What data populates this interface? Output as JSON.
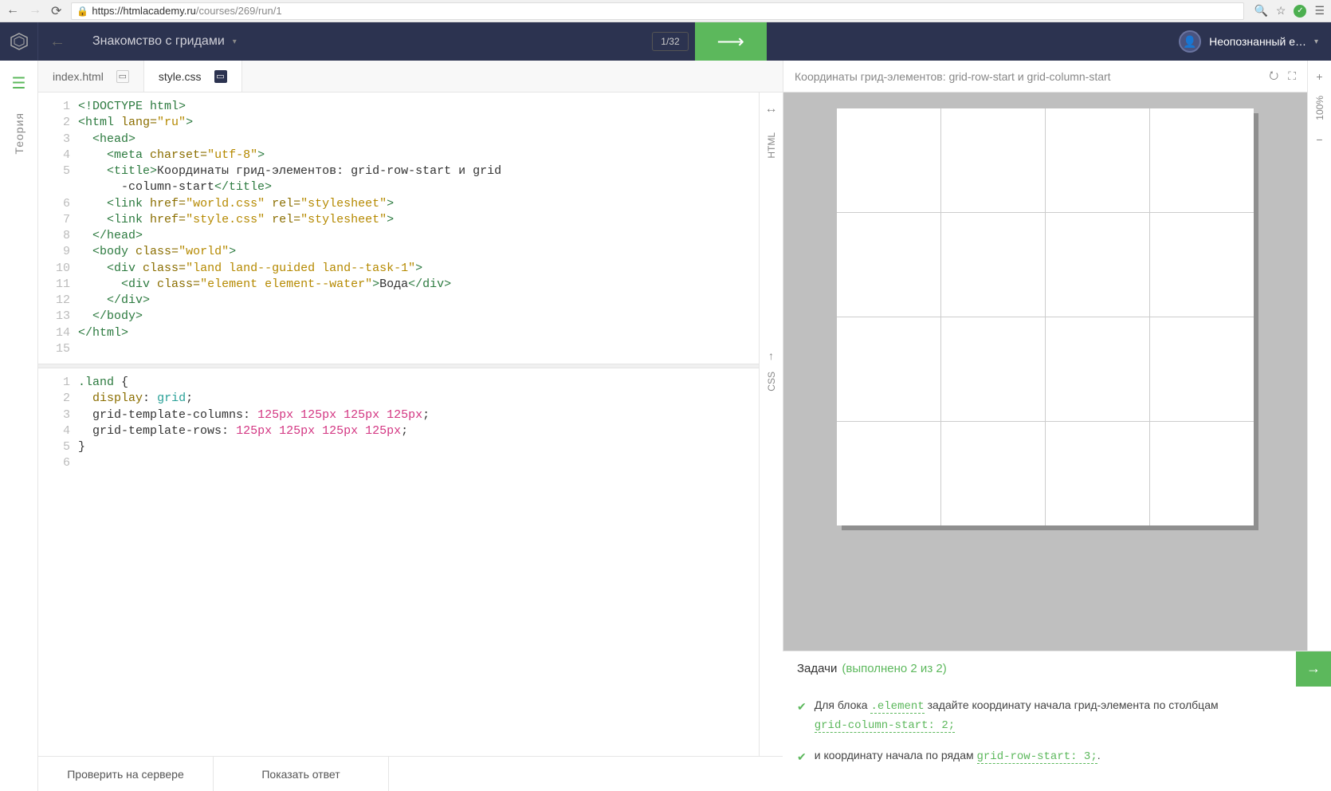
{
  "browser": {
    "url_scheme": "https",
    "url_host": "://htmlacademy.ru",
    "url_path": "/courses/269/run/1"
  },
  "header": {
    "course_title": "Знакомство с гридами",
    "progress": "1/32",
    "username": "Неопознанный е…"
  },
  "sidebar": {
    "theory_label": "Теория"
  },
  "tabs": [
    {
      "label": "index.html"
    },
    {
      "label": "style.css"
    }
  ],
  "lang_labels": {
    "html": "HTML",
    "css": "CSS"
  },
  "preview": {
    "title": "Координаты грид-элементов: grid-row-start и grid-column-start",
    "zoom": "100%"
  },
  "tasks": {
    "title": "Задачи",
    "progress": "(выполнено 2 из 2)",
    "items": [
      {
        "pre": "Для блока ",
        "code1": ".element",
        "mid": " задайте координату начала грид-элемента по столбцам ",
        "code2": "grid-column-start: 2;",
        "post": ""
      },
      {
        "pre": "и координату начала по рядам ",
        "code1": "grid-row-start: 3;",
        "mid": "",
        "code2": "",
        "post": "."
      }
    ]
  },
  "footer": {
    "check": "Проверить на сервере",
    "answer": "Показать ответ"
  },
  "html_code": {
    "lines": 15,
    "l1": "<!DOCTYPE html>",
    "l2": "<html lang=\"ru\">",
    "l3": "  <head>",
    "l4": "    <meta charset=\"utf-8\">",
    "l5a": "    <title>",
    "l5b": "Координаты грид-элементов: grid-row-start и grid",
    "l5c": "      -column-start",
    "l5d": "</title>",
    "l6": "    <link href=\"world.css\" rel=\"stylesheet\">",
    "l7": "    <link href=\"style.css\" rel=\"stylesheet\">",
    "l8": "  </head>",
    "l9": "  <body class=\"world\">",
    "l10": "    <div class=\"land land--guided land--task-1\">",
    "l11a": "      <div class=\"element element--water\">",
    "l11b": "Вода",
    "l11c": "</div>",
    "l12": "    </div>",
    "l13": "  </body>",
    "l14": "</html>"
  },
  "css_code": {
    "lines": 6,
    "l1": ".land {",
    "l2a": "  display",
    "l2b": ": grid;",
    "l3a": "  grid-template-columns: ",
    "l3b": "125px 125px 125px 125px",
    "l3c": ";",
    "l4a": "  grid-template-rows: ",
    "l4b": "125px 125px 125px 125px",
    "l4c": ";",
    "l5": "}"
  }
}
